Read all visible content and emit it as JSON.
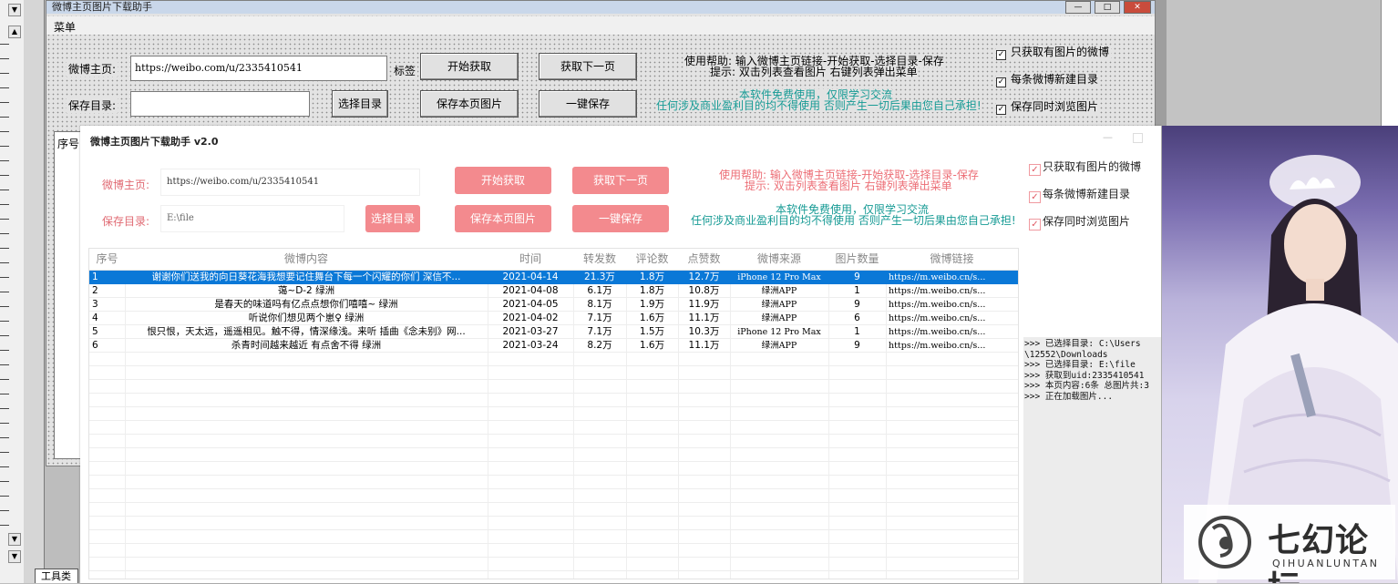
{
  "bottom_tab": "工具类",
  "old_window": {
    "title": "微博主页图片下载助手",
    "menu": "菜单",
    "home_label": "微博主页:",
    "home_value": "https://weibo.com/u/2335410541",
    "tag_label": "标签",
    "start_btn": "开始获取",
    "next_btn": "获取下一页",
    "save_dir_label": "保存目录:",
    "select_dir_btn": "选择目录",
    "save_page_btn": "保存本页图片",
    "one_key_btn": "一键保存",
    "help_line1": "使用帮助:   输入微博主页链接-开始获取-选择目录-保存",
    "help_line2": "提示:   双击列表查看图片  右键列表弹出菜单",
    "notice_line1": "本软件免费使用，仅限学习交流",
    "notice_line2": "任何涉及商业盈利目的均不得使用 否则产生一切后果由您自己承担!",
    "cb1": "只获取有图片的微博",
    "cb2": "每条微博新建目录",
    "cb3": "保存同时浏览图片",
    "list_header": "序号"
  },
  "new_window": {
    "title": "微博主页图片下载助手 v2.0",
    "home_label": "微博主页:",
    "home_value": "https://weibo.com/u/2335410541",
    "save_dir_label": "保存目录:",
    "save_dir_value": "E:\\file",
    "select_dir_btn": "选择目录",
    "start_btn": "开始获取",
    "next_btn": "获取下一页",
    "save_page_btn": "保存本页图片",
    "one_key_btn": "一键保存",
    "help_line1": "使用帮助:   输入微博主页链接-开始获取-选择目录-保存",
    "help_line2": "提示:   双击列表查看图片  右键列表弹出菜单",
    "notice_line1": "本软件免费使用，仅限学习交流",
    "notice_line2": "任何涉及商业盈利目的均不得使用 否则产生一切后果由您自己承担!",
    "cb1": "只获取有图片的微博",
    "cb2": "每条微博新建目录",
    "cb3": "保存同时浏览图片",
    "table": {
      "headers": [
        "序号",
        "微博内容",
        "时间",
        "转发数",
        "评论数",
        "点赞数",
        "微博来源",
        "图片数量",
        "微博链接"
      ],
      "rows": [
        [
          "1",
          "谢谢你们送我的向日葵花海我想要记住舞台下每一个闪耀的你们 深信不...",
          "2021-04-14",
          "21.3万",
          "1.8万",
          "12.7万",
          "iPhone 12 Pro Max",
          "9",
          "https://m.weibo.cn/s..."
        ],
        [
          "2",
          "蔼~D-2 绿洲",
          "2021-04-08",
          "6.1万",
          "1.8万",
          "10.8万",
          "绿洲APP",
          "1",
          "https://m.weibo.cn/s..."
        ],
        [
          "3",
          "是春天的味道吗有亿点点想你们嘻嘻~ 绿洲",
          "2021-04-05",
          "8.1万",
          "1.9万",
          "11.9万",
          "绿洲APP",
          "9",
          "https://m.weibo.cn/s..."
        ],
        [
          "4",
          "听说你们想见两个崽♀ 绿洲",
          "2021-04-02",
          "7.1万",
          "1.6万",
          "11.1万",
          "绿洲APP",
          "6",
          "https://m.weibo.cn/s..."
        ],
        [
          "5",
          "恨只恨，天太远，遥遥相见。触不得，情深缘浅。来听 插曲《念未别》网...",
          "2021-03-27",
          "7.1万",
          "1.5万",
          "10.3万",
          "iPhone 12 Pro Max",
          "1",
          "https://m.weibo.cn/s..."
        ],
        [
          "6",
          "杀青时间越来越近 有点舍不得 绿洲",
          "2021-03-24",
          "8.2万",
          "1.6万",
          "11.1万",
          "绿洲APP",
          "9",
          "https://m.weibo.cn/s..."
        ]
      ]
    },
    "log_lines": [
      ">>> 已选择目录: C:\\Users",
      "\\12552\\Downloads",
      ">>> 已选择目录: E:\\file",
      ">>> 获取到uid:2335410541",
      ">>> 本页内容:6条 总图片共:3",
      ">>> 正在加载图片..."
    ]
  },
  "watermark": {
    "main": "七幻论坛",
    "sub": "QIHUANLUNTAN"
  },
  "colors": {
    "accent_pink": "#f38a8e",
    "label_red": "#e06a73",
    "teal": "#159a94",
    "selection_blue": "#0a78d7"
  }
}
